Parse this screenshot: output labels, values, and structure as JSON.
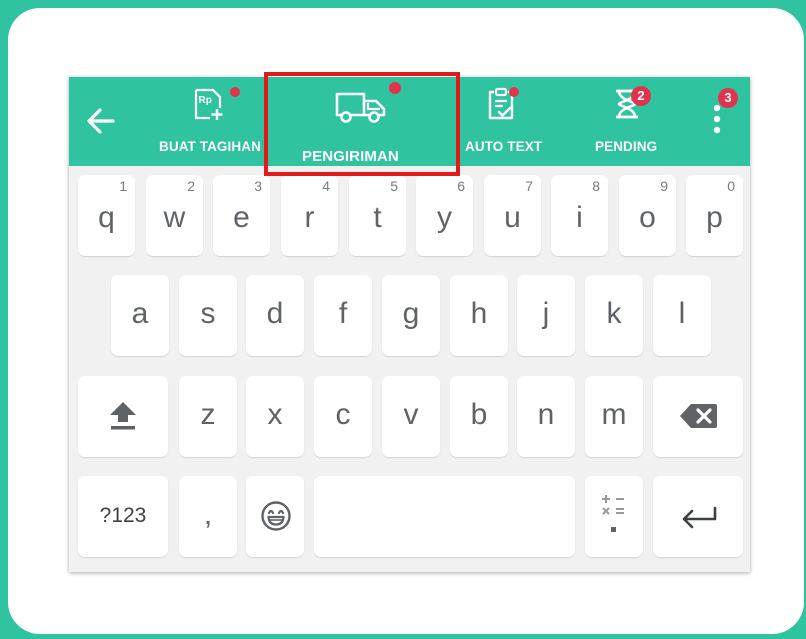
{
  "toolbar": {
    "buat_tagihan": {
      "label": "BUAT TAGIHAN",
      "icon": "invoice-rp-icon"
    },
    "pengiriman": {
      "label": "PENGIRIMAN",
      "icon": "delivery-truck-icon"
    },
    "auto_text": {
      "label": "AUTO TEXT",
      "icon": "clipboard-check-icon"
    },
    "pending": {
      "label": "PENDING",
      "icon": "hourglass-icon",
      "badge": "2"
    },
    "more": {
      "icon": "more-vertical-icon",
      "badge": "3"
    }
  },
  "keyboard": {
    "row1": [
      {
        "ch": "q",
        "hint": "1"
      },
      {
        "ch": "w",
        "hint": "2"
      },
      {
        "ch": "e",
        "hint": "3"
      },
      {
        "ch": "r",
        "hint": "4"
      },
      {
        "ch": "t",
        "hint": "5"
      },
      {
        "ch": "y",
        "hint": "6"
      },
      {
        "ch": "u",
        "hint": "7"
      },
      {
        "ch": "i",
        "hint": "8"
      },
      {
        "ch": "o",
        "hint": "9"
      },
      {
        "ch": "p",
        "hint": "0"
      }
    ],
    "row2": [
      "a",
      "s",
      "d",
      "f",
      "g",
      "h",
      "j",
      "k",
      "l"
    ],
    "row3": [
      "z",
      "x",
      "c",
      "v",
      "b",
      "n",
      "m"
    ],
    "symbols_label": "?123",
    "comma": ",",
    "icons": {
      "shift": "shift-icon",
      "backspace": "backspace-icon",
      "emoji": "emoji-icon",
      "calculator": "calculator-icon",
      "enter": "enter-icon",
      "back": "back-arrow-icon"
    }
  },
  "colors": {
    "brand_green": "#2fc3a0",
    "notification_red": "#e2334c",
    "highlight_red": "#e11b1b",
    "keyboard_bg": "#f1f1f1"
  }
}
